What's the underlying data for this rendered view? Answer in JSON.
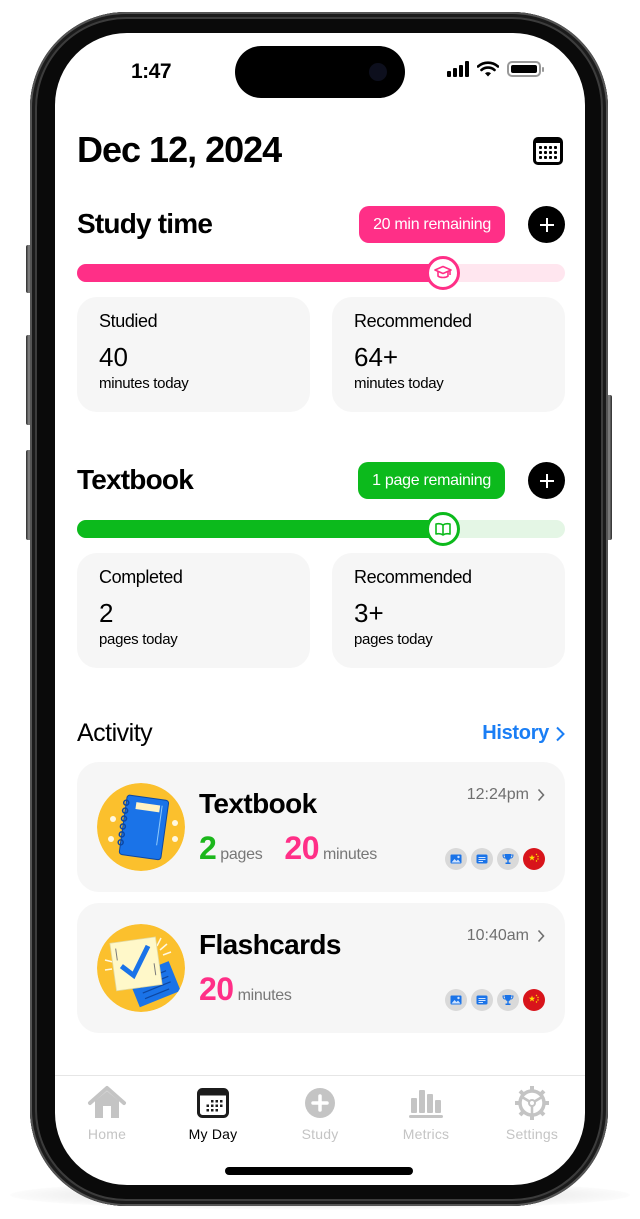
{
  "status_bar": {
    "time": "1:47",
    "icons": [
      "cellular-signal-icon",
      "wifi-icon",
      "battery-icon"
    ]
  },
  "header": {
    "date": "Dec 12, 2024",
    "calendar_icon": "calendar-icon"
  },
  "study_time": {
    "title": "Study time",
    "badge": "20 min remaining",
    "progress_percent": 75,
    "knob_icon": "graduation-cap-icon",
    "cards": [
      {
        "label": "Studied",
        "value": "40",
        "unit": "minutes today"
      },
      {
        "label": "Recommended",
        "value": "64+",
        "unit": "minutes today"
      }
    ]
  },
  "textbook": {
    "title": "Textbook",
    "badge": "1 page remaining",
    "progress_percent": 75,
    "knob_icon": "open-book-icon",
    "cards": [
      {
        "label": "Completed",
        "value": "2",
        "unit": "pages today"
      },
      {
        "label": "Recommended",
        "value": "3+",
        "unit": "pages today"
      }
    ]
  },
  "activity": {
    "title": "Activity",
    "history_link": "History",
    "items": [
      {
        "name": "Textbook",
        "time": "12:24pm",
        "stats": [
          {
            "value": "2",
            "unit": "pages",
            "color": "#1cb71c"
          },
          {
            "value": "20",
            "unit": "minutes",
            "color": "#ff2f87"
          }
        ],
        "tags": [
          "image-icon",
          "text-card-icon",
          "trophy-icon",
          "china-flag-icon"
        ]
      },
      {
        "name": "Flashcards",
        "time": "10:40am",
        "stats": [
          {
            "value": "20",
            "unit": "minutes",
            "color": "#ff2f87"
          }
        ],
        "tags": [
          "image-icon",
          "text-card-icon",
          "trophy-icon",
          "china-flag-icon"
        ]
      }
    ]
  },
  "tabbar": {
    "active": "My Day",
    "tabs": [
      {
        "label": "Home",
        "icon": "home-icon"
      },
      {
        "label": "My Day",
        "icon": "calendar-icon"
      },
      {
        "label": "Study",
        "icon": "plus-circle-icon"
      },
      {
        "label": "Metrics",
        "icon": "bar-chart-icon"
      },
      {
        "label": "Settings",
        "icon": "gear-icon"
      }
    ]
  },
  "colors": {
    "pink": "#ff2f87",
    "pink_light": "#ffe6ef",
    "green": "#0cba1c",
    "green_light": "#e4f6e5",
    "link_blue": "#1a7ef5",
    "card_bg": "#f6f6f6"
  }
}
